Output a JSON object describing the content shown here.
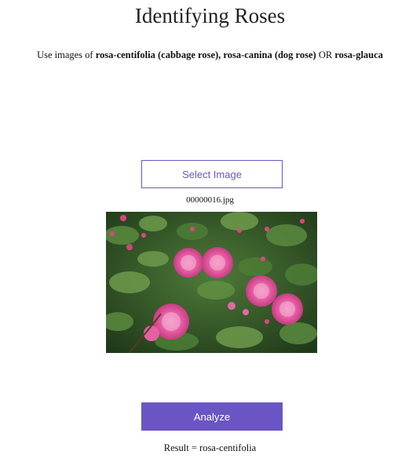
{
  "page": {
    "title": "Identifying Roses"
  },
  "instructions": {
    "prefix": "Use images of ",
    "rose1": "rosa-centifolia (cabbage rose),",
    "sep1": " ",
    "rose2": "rosa-canina (dog rose)",
    "sep2": " OR ",
    "rose3": "rosa-glauca"
  },
  "upload": {
    "select_label": "Select Image",
    "file_name": "00000016.jpg"
  },
  "preview": {
    "subject": "pink roses on a green bush"
  },
  "analyze": {
    "label": "Analyze"
  },
  "result": {
    "text": "Result = rosa-centifolia"
  },
  "colors": {
    "accent": "#6b55c4",
    "text": "#111111",
    "background": "#ffffff"
  }
}
